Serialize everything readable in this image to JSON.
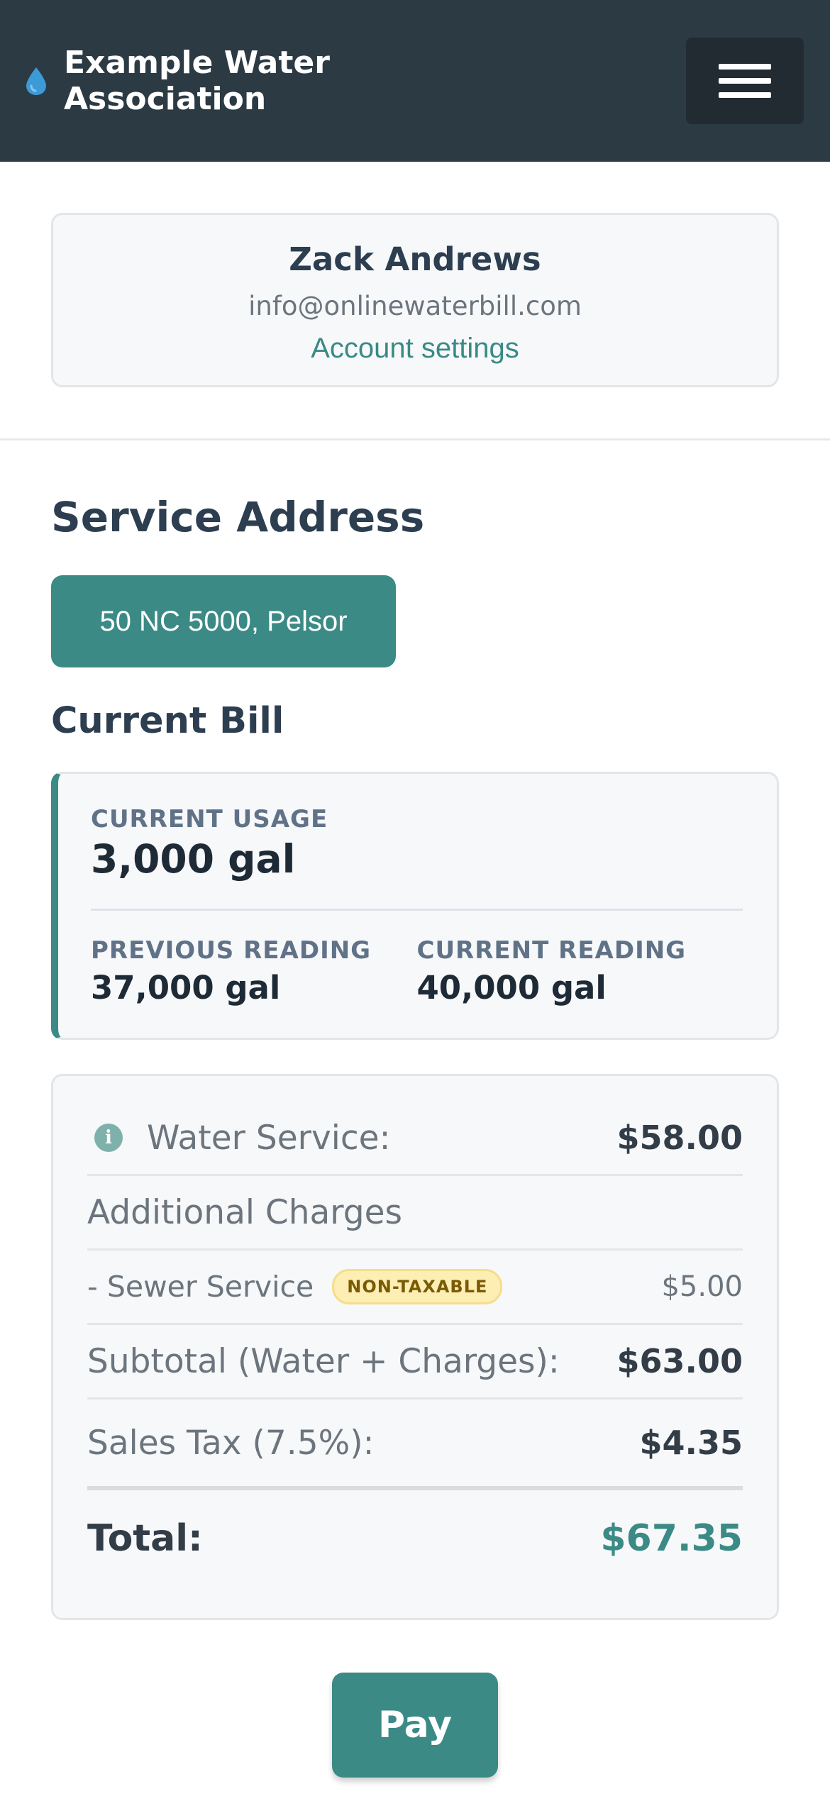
{
  "header": {
    "brand_name": "Example Water Association",
    "brand_icon": "water-drop-icon",
    "menu_icon": "hamburger-menu-icon"
  },
  "profile": {
    "name": "Zack Andrews",
    "email": "info@onlinewaterbill.com",
    "settings_link": "Account settings"
  },
  "service_address": {
    "title": "Service Address",
    "address": "50 NC 5000, Pelsor"
  },
  "current_bill": {
    "title": "Current Bill",
    "usage_label": "CURRENT USAGE",
    "usage_value": "3,000 gal",
    "previous_reading_label": "PREVIOUS READING",
    "previous_reading_value": "37,000 gal",
    "current_reading_label": "CURRENT READING",
    "current_reading_value": "40,000 gal"
  },
  "charges": {
    "water_service_label": "Water Service:",
    "water_service_amount": "$58.00",
    "additional_charges_label": "Additional Charges",
    "sewer_service_label": "- Sewer Service",
    "sewer_service_badge": "NON-TAXABLE",
    "sewer_service_amount": "$5.00",
    "subtotal_label": "Subtotal (Water + Charges):",
    "subtotal_amount": "$63.00",
    "tax_label": "Sales Tax (7.5%):",
    "tax_amount": "$4.35",
    "total_label": "Total:",
    "total_amount": "$67.35"
  },
  "actions": {
    "pay_label": "Pay"
  },
  "colors": {
    "header_bg": "#2c3a44",
    "accent": "#3b8a86",
    "badge_bg": "#fdeeb4"
  }
}
